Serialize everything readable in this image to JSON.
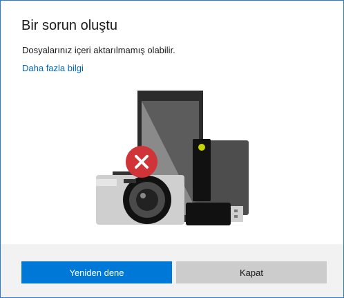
{
  "dialog": {
    "title": "Bir sorun oluştu",
    "message": "Dosyalarınız içeri aktarılmamış olabilir.",
    "link_label": "Daha fazla bilgi"
  },
  "illustration": {
    "icons": [
      "phone-icon",
      "camera-icon",
      "hard-drive-icon",
      "usb-drive-icon",
      "error-icon"
    ],
    "error_color": "#d13438"
  },
  "buttons": {
    "retry_label": "Yeniden dene",
    "close_label": "Kapat"
  },
  "colors": {
    "accent": "#0078d7",
    "link": "#0067b8",
    "footer_bg": "#f2f2f2",
    "secondary_button": "#cccccc"
  }
}
